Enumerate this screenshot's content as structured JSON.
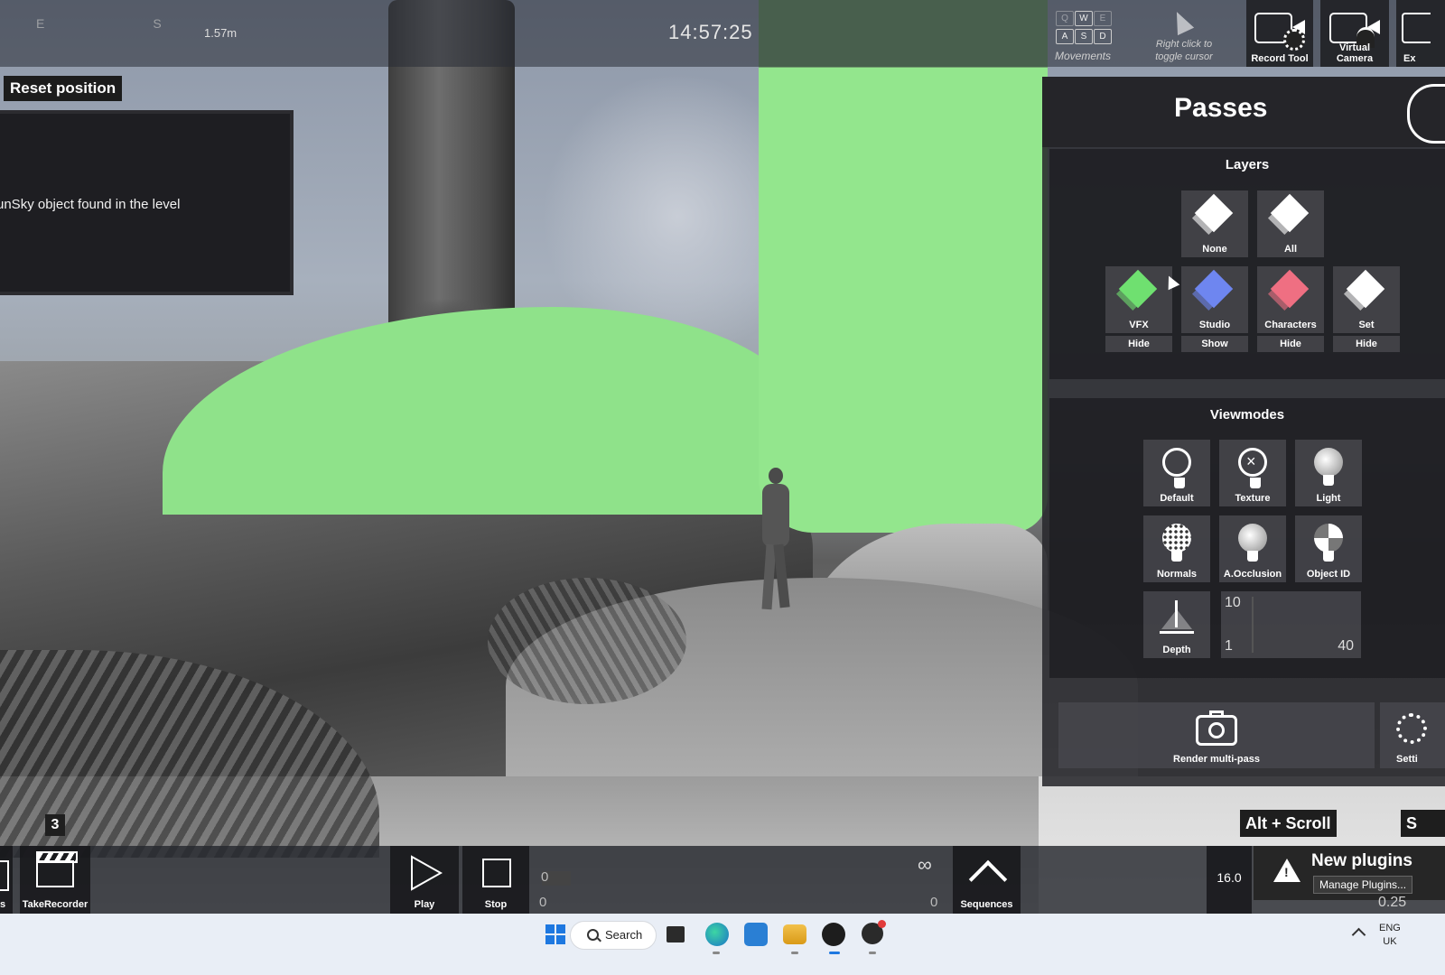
{
  "hud": {
    "compass": [
      "E",
      "",
      "S",
      ""
    ],
    "distance": "1.57m",
    "clock": "14:57:25",
    "movements": {
      "keys": [
        "Q",
        "W",
        "E",
        "A",
        "S",
        "D"
      ],
      "label": "Movements"
    },
    "cursor_hint": [
      "Right click to",
      "toggle cursor"
    ],
    "tools": [
      {
        "label": "Record Tool",
        "icon": "record-camera-icon"
      },
      {
        "label": "Virtual Camera",
        "icon": "virtual-camera-icon"
      },
      {
        "label": "Ex",
        "icon": "export-icon"
      }
    ]
  },
  "left": {
    "reset_button": "Reset position",
    "message": "unSky object found in the level",
    "camera_number": "3"
  },
  "passes": {
    "title": "Passes",
    "layers": {
      "title": "Layers",
      "presets": [
        {
          "label": "None",
          "color": "#ffffff"
        },
        {
          "label": "All",
          "color": "#ffffff"
        }
      ],
      "items": [
        {
          "label": "VFX",
          "color": "#6fe070",
          "toggle": "Hide"
        },
        {
          "label": "Studio",
          "color": "#6e86f0",
          "toggle": "Show"
        },
        {
          "label": "Characters",
          "color": "#ef6f82",
          "toggle": "Hide"
        },
        {
          "label": "Set",
          "color": "#ffffff",
          "toggle": "Hide"
        }
      ]
    },
    "viewmodes": {
      "title": "Viewmodes",
      "items": [
        {
          "label": "Default",
          "icon": "bulb-outline-icon"
        },
        {
          "label": "Texture",
          "icon": "bulb-x-icon"
        },
        {
          "label": "Light",
          "icon": "bulb-icon"
        },
        {
          "label": "Normals",
          "icon": "bulb-dotted-icon"
        },
        {
          "label": "A.Occlusion",
          "icon": "bulb-shaded-icon"
        },
        {
          "label": "Object ID",
          "icon": "bulb-segmented-icon"
        },
        {
          "label": "Depth",
          "icon": "depth-icon"
        }
      ],
      "depth_range": {
        "top": "10",
        "min": "1",
        "max": "40"
      }
    },
    "render_button": "Render multi-pass",
    "settings_button": "Setti"
  },
  "hints": {
    "alt_scroll": "Alt + Scroll",
    "s_key": "S"
  },
  "bottom": {
    "left_partial": "s",
    "take_recorder": "TakeRecorder",
    "play": "Play",
    "stop": "Stop",
    "timeline": {
      "top_left": "0",
      "bottom_left": "0",
      "bottom_right": "0"
    },
    "sequences": "Sequences",
    "fps": "16.0",
    "notification": {
      "title": "New plugins",
      "button": "Manage Plugins...",
      "sub": "0.25"
    }
  },
  "taskbar": {
    "search": "Search",
    "lang": [
      "ENG",
      "UK"
    ]
  }
}
